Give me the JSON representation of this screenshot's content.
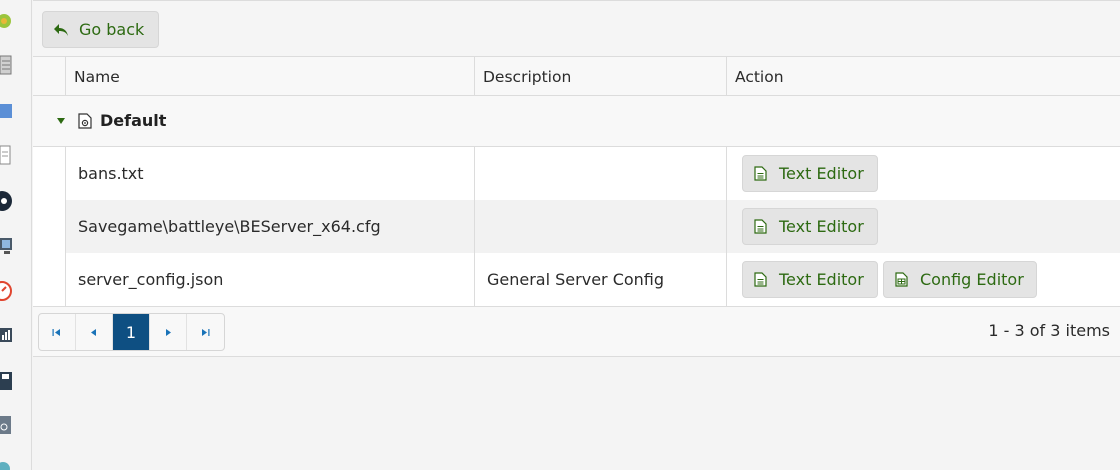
{
  "toolbar": {
    "go_back_label": "Go back"
  },
  "grid": {
    "columns": [
      {
        "label": "Name"
      },
      {
        "label": "Description"
      },
      {
        "label": "Action"
      }
    ],
    "group": {
      "label": "Default"
    },
    "rows": [
      {
        "name": "bans.txt",
        "description": "",
        "actions": [
          "Text Editor"
        ]
      },
      {
        "name": "Savegame\\battleye\\BEServer_x64.cfg",
        "description": "",
        "actions": [
          "Text Editor"
        ]
      },
      {
        "name": "server_config.json",
        "description": "General Server Config",
        "actions": [
          "Text Editor",
          "Config Editor"
        ]
      }
    ]
  },
  "pager": {
    "current_page": "1",
    "info": "1 - 3 of 3 items"
  },
  "colors": {
    "accent_green": "#2d6a12",
    "active_page": "#0e4f82"
  }
}
